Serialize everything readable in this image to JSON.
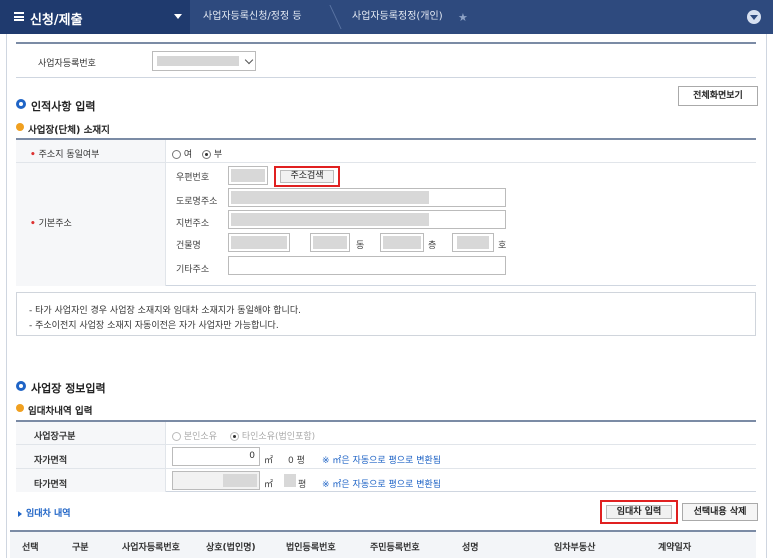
{
  "nav": {
    "home_label": "신청/제출",
    "breadcrumb_1": "사업자등록신청/정정 등",
    "breadcrumb_2": "사업자등록정정(개인)",
    "star_icon": "star-icon",
    "collapse_icon": "chevron-down-icon"
  },
  "regno": {
    "label": "사업자등록번호"
  },
  "personal": {
    "section_title": "인적사항 입력",
    "full_view_button": "전체화면보기",
    "location_title": "사업장(단체) 소재지",
    "same_address_label": "주소지 동일여부",
    "option_yes": "여",
    "option_no": "부",
    "base_address_label": "기본주소",
    "postcode_label": "우편번호",
    "address_search_button": "주소검색",
    "road_address_label": "도로명주소",
    "lot_address_label": "지번주소",
    "building_label": "건물명",
    "dong_unit": "동",
    "floor_unit": "층",
    "ho_unit": "호",
    "other_address_label": "기타주소"
  },
  "notice": {
    "line1": "- 타가 사업자인 경우 사업장 소재지와 임대차 소재지가 동일해야 합니다.",
    "line2": "- 주소이전지 사업장 소재지 자동이전은 자가 사업자만 가능합니다."
  },
  "business": {
    "section_title": "사업장 정보입력",
    "lease_title": "임대차내역 입력",
    "type_label": "사업장구분",
    "type_option_own": "본인소유",
    "type_option_other": "타인소유(법인포함)",
    "own_area_label": "자가면적",
    "own_area_value": "0",
    "own_area_unit": "㎡",
    "own_area_pyeong": "0 평",
    "convert_note": "※ ㎡은 자동으로 평으로 변환됨",
    "other_area_label": "타가면적",
    "other_area_unit": "㎡",
    "other_area_pyeong_unit": "평",
    "convert_note_2": "※ ㎡은 자동으로 평으로 변환됨"
  },
  "lease": {
    "list_title": "임대차 내역",
    "input_button": "임대차 입력",
    "delete_button": "선택내용 삭제",
    "columns": [
      "선택",
      "구분",
      "사업자등록번호",
      "상호(법인명)",
      "법인등록번호",
      "주민등록번호",
      "성명",
      "임차부동산",
      "계약일자"
    ]
  }
}
